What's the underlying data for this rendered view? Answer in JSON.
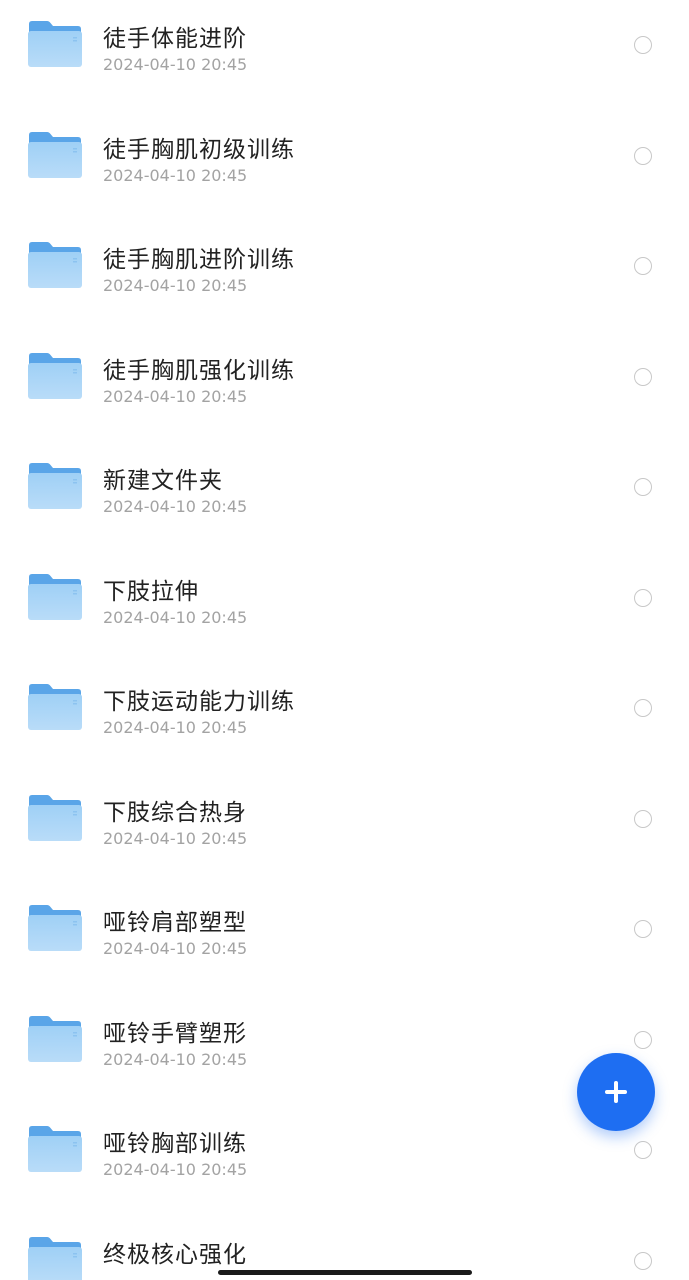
{
  "folders": [
    {
      "name": "徒手体能进阶",
      "date": "2024-04-10 20:45"
    },
    {
      "name": "徒手胸肌初级训练",
      "date": "2024-04-10 20:45"
    },
    {
      "name": "徒手胸肌进阶训练",
      "date": "2024-04-10 20:45"
    },
    {
      "name": "徒手胸肌强化训练",
      "date": "2024-04-10 20:45"
    },
    {
      "name": "新建文件夹",
      "date": "2024-04-10 20:45"
    },
    {
      "name": "下肢拉伸",
      "date": "2024-04-10 20:45"
    },
    {
      "name": "下肢运动能力训练",
      "date": "2024-04-10 20:45"
    },
    {
      "name": "下肢综合热身",
      "date": "2024-04-10 20:45"
    },
    {
      "name": "哑铃肩部塑型",
      "date": "2024-04-10 20:45"
    },
    {
      "name": "哑铃手臂塑形",
      "date": "2024-04-10 20:45"
    },
    {
      "name": "哑铃胸部训练",
      "date": "2024-04-10 20:45"
    },
    {
      "name": "终极核心强化",
      "date": ""
    }
  ],
  "icons": {
    "folder": "folder-icon",
    "select": "radio-unchecked-icon",
    "add": "plus-icon"
  },
  "colors": {
    "accent": "#1e6ef2",
    "folder": "#7fbdf0"
  }
}
